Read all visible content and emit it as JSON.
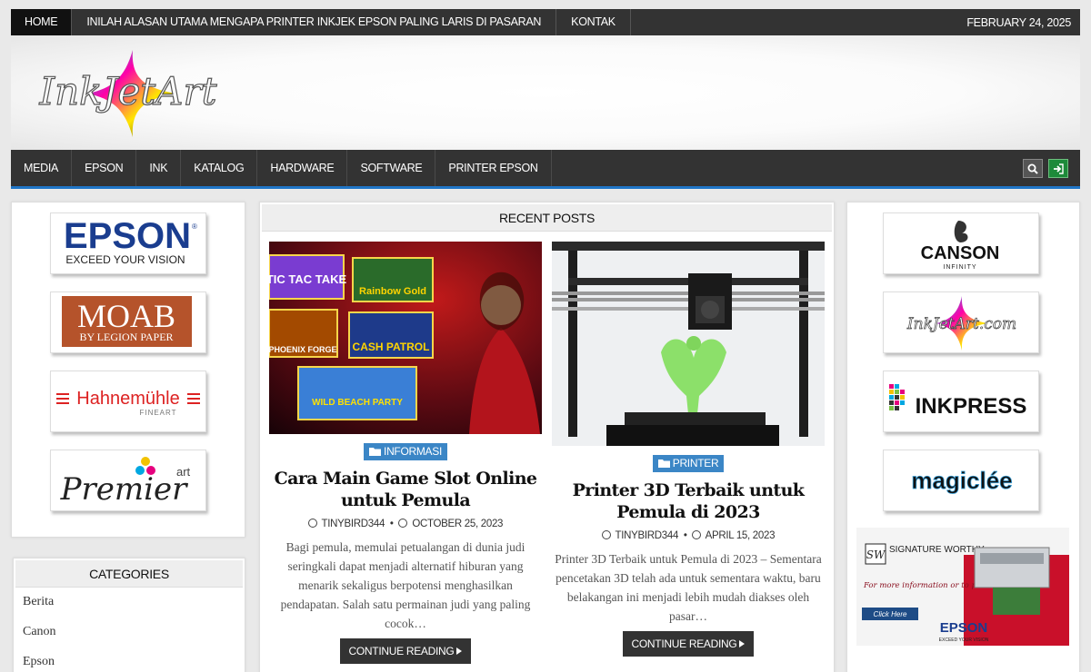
{
  "topbar": {
    "home": "HOME",
    "article": "INILAH ALASAN UTAMA MENGAPA PRINTER INKJEK EPSON PALING LARIS DI PASARAN",
    "contact": "KONTAK",
    "date": "FEBRUARY 24, 2025"
  },
  "site": {
    "logo_text": "InkJetArt"
  },
  "nav": [
    "MEDIA",
    "EPSON",
    "INK",
    "KATALOG",
    "HARDWARE",
    "SOFTWARE",
    "PRINTER EPSON"
  ],
  "left_logos": {
    "epson": {
      "name": "EPSON",
      "tagline": "EXCEED YOUR VISION"
    },
    "moab": {
      "name": "MOAB",
      "tagline": "BY LEGION PAPER"
    },
    "hahnemuhle": {
      "name": "Hahnemühle",
      "tagline": "FINEART"
    },
    "premier": {
      "name": "Premier",
      "tagline": "art"
    }
  },
  "categories": {
    "title": "CATEGORIES",
    "items": [
      "Berita",
      "Canon",
      "Epson"
    ]
  },
  "recent": {
    "title": "RECENT POSTS",
    "posts": [
      {
        "category": "INFORMASI",
        "title": "Cara Main Game Slot Online untuk Pemula",
        "author": "TINYBIRD344",
        "date": "OCTOBER 25, 2023",
        "excerpt": "Bagi pemula, memulai petualangan di dunia judi seringkali dapat menjadi alternatif hiburan yang menarik sekaligus berpotensi menghasilkan pendapatan. Salah satu permainan judi yang paling cocok…",
        "read_more": "CONTINUE READING",
        "image_labels": {
          "a": "TIC TAC TAKE",
          "b": "Rainbow Gold",
          "c": "PHOENIX FORGE",
          "d": "CASH PATROL",
          "e": "WILD BEACH PARTY"
        }
      },
      {
        "category": "PRINTER",
        "title": "Printer 3D Terbaik untuk Pemula di 2023",
        "author": "TINYBIRD344",
        "date": "APRIL 15, 2023",
        "excerpt": "Printer 3D Terbaik untuk Pemula di 2023 – Sementara pencetakan 3D telah ada untuk sementara waktu, baru belakangan ini menjadi lebih mudah diakses oleh pasar…",
        "read_more": "CONTINUE READING"
      }
    ]
  },
  "right_logos": {
    "canson": {
      "name": "CANSON",
      "tagline": "INFINITY"
    },
    "inkjetart": {
      "name": "InkJetArt.com"
    },
    "inkpress": {
      "name": "INKPRESS"
    },
    "magiclee": {
      "name": "magiclée"
    }
  },
  "ad": {
    "brand": "SIGNATURE WORTHY",
    "line": "For more information or to purchase",
    "button": "Click Here",
    "epson": "EPSON",
    "epson_tagline": "EXCEED YOUR VISION"
  }
}
